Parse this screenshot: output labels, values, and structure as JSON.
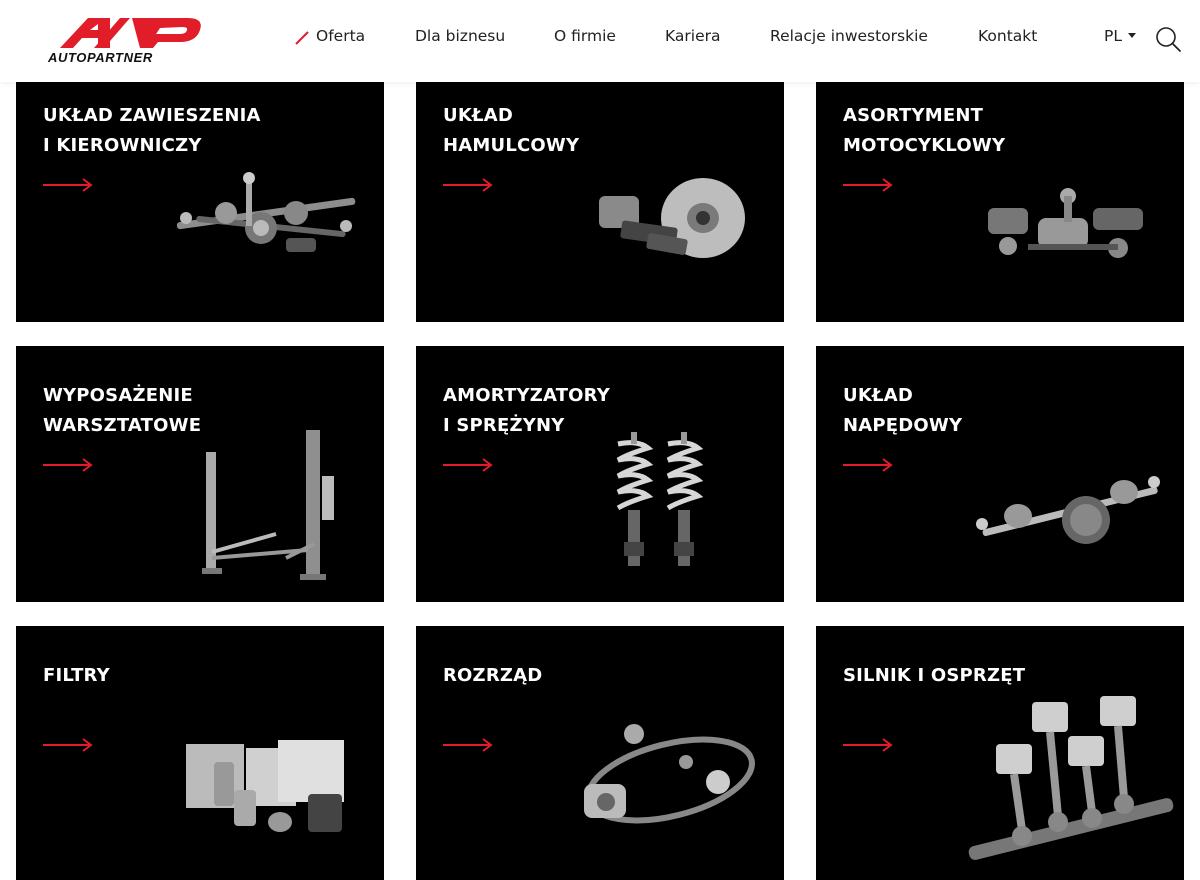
{
  "brand": {
    "logo_text": "AUTOPARTNER",
    "accent_color": "#e11d2a"
  },
  "nav": {
    "items": [
      {
        "label": "Oferta"
      },
      {
        "label": "Dla biznesu"
      },
      {
        "label": "O firmie"
      },
      {
        "label": "Kariera"
      },
      {
        "label": "Relacje inwestorskie"
      },
      {
        "label": "Kontakt"
      }
    ],
    "active": "Oferta",
    "language": "PL",
    "search_icon": "search-icon"
  },
  "categories": [
    {
      "line1": "UKŁAD ZAWIESZENIA",
      "line2": "I KIEROWNICZY",
      "icon": "suspension-steering-parts-image"
    },
    {
      "line1": "UKŁAD",
      "line2": "HAMULCOWY",
      "icon": "brake-parts-image"
    },
    {
      "line1": "ASORTYMENT",
      "line2": "MOTOCYKLOWY",
      "icon": "motorcycle-parts-image"
    },
    {
      "line1": "WYPOSAŻENIE",
      "line2": "WARSZTATOWE",
      "icon": "car-lift-image"
    },
    {
      "line1": "AMORTYZATORY",
      "line2": "I SPRĘŻYNY",
      "icon": "shock-absorbers-image"
    },
    {
      "line1": "UKŁAD",
      "line2": "NAPĘDOWY",
      "icon": "drive-shaft-image"
    },
    {
      "line1": "FILTRY",
      "line2": "",
      "icon": "filters-image"
    },
    {
      "line1": "ROZRZĄD",
      "line2": "",
      "icon": "timing-belt-kit-image"
    },
    {
      "line1": "SILNIK I OSPRZĘT",
      "line2": "",
      "icon": "engine-pistons-image"
    }
  ]
}
